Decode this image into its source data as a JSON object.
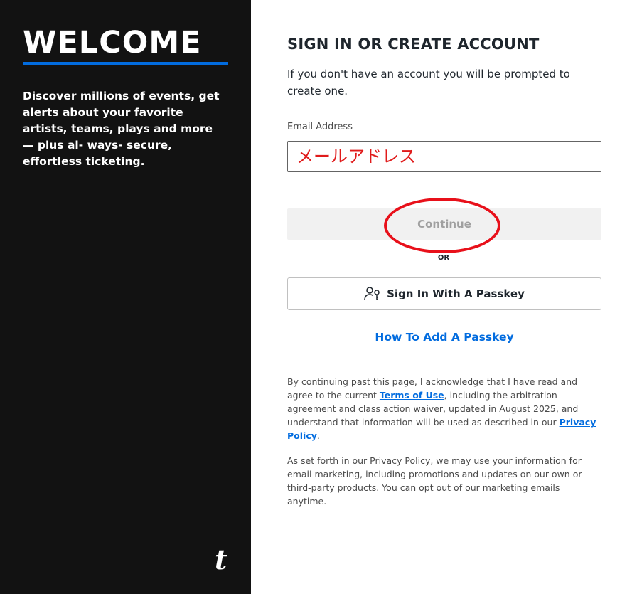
{
  "left": {
    "title": "WELCOME",
    "description": "Discover millions of events, get alerts about your favorite artists, teams, plays and more — plus al- ways- secure, effortless ticketing.",
    "logo_text": "t"
  },
  "form": {
    "title": "SIGN IN OR CREATE ACCOUNT",
    "subtitle": "If you don't have an account you will be prompted to create one.",
    "email_label": "Email Address",
    "email_placeholder": "メールアドレス",
    "email_value": "",
    "continue_label": "Continue",
    "or_label": "OR",
    "passkey_label": "Sign In With A Passkey",
    "howto_link": "How To Add A Passkey"
  },
  "legal": {
    "p1_before_terms": "By continuing past this page, I acknowledge that I have read and agree to the current ",
    "terms_link": "Terms of Use",
    "p1_middle": ", including the arbitration agreement and class action waiver, updated in August 2025, and understand that information will be used as described in our ",
    "privacy_link": "Privacy Policy",
    "p1_end": ".",
    "p2": "As set forth in our Privacy Policy, we may use your information for email marketing, including promotions and updates on our own or third-party products. You can opt out of our marketing emails anytime."
  },
  "colors": {
    "left_bg": "#121212",
    "accent_blue": "#026cdf",
    "annotation_red": "#e8101a"
  },
  "icons": {
    "passkey": "passkey-icon",
    "brand": "brand-logo"
  }
}
